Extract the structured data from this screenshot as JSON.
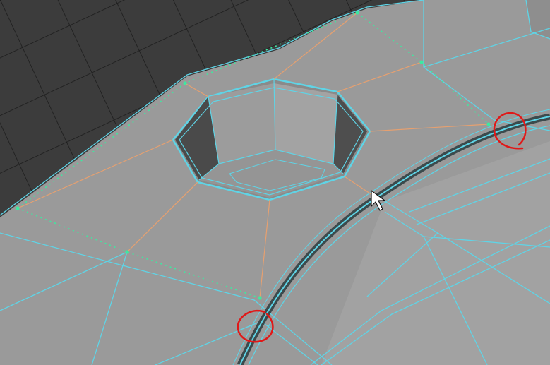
{
  "viewport": {
    "label": "",
    "wireframe_color": "#5fd4e6",
    "selected_edge_color": "#e6a070",
    "vertex_path_color": "#3ee8a0",
    "annotation_color": "#e01818",
    "surface_color": "#9a9a9a",
    "grid_background_color": "#3c3c3c"
  },
  "scene": {
    "object": "polygon-mesh",
    "feature": "octagonal-hole",
    "highlight": "two-red-circle-annotations"
  },
  "cursor": {
    "icon": "arrow-cursor-icon"
  }
}
